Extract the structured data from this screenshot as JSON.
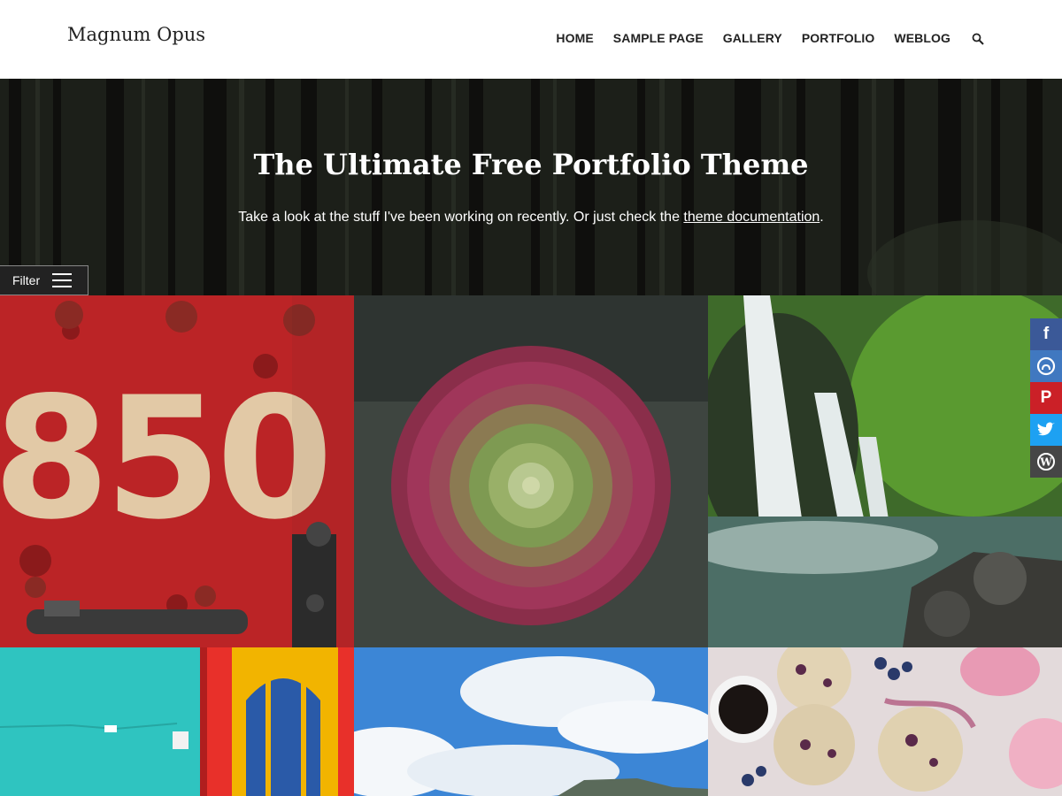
{
  "site": {
    "title": "Magnum Opus"
  },
  "nav": {
    "items": [
      {
        "label": "HOME"
      },
      {
        "label": "SAMPLE PAGE"
      },
      {
        "label": "GALLERY"
      },
      {
        "label": "PORTFOLIO"
      },
      {
        "label": "WEBLOG"
      }
    ],
    "search_icon": "search-icon"
  },
  "hero": {
    "title": "The Ultimate Free Portfolio Theme",
    "subtitle_prefix": "Take a look at the stuff I've been working on recently. Or just check the ",
    "subtitle_link": "theme documentation",
    "subtitle_suffix": "."
  },
  "filter": {
    "label": "Filter",
    "icon": "menu-icon"
  },
  "portfolio": {
    "items": [
      {
        "name": "rusty-850-plate"
      },
      {
        "name": "succulent-flower"
      },
      {
        "name": "waterfall"
      },
      {
        "name": "painted-door"
      },
      {
        "name": "blue-sky"
      },
      {
        "name": "blueberry-cookies"
      }
    ]
  },
  "social": {
    "items": [
      {
        "icon": "facebook-icon",
        "glyph": "f",
        "color": "#3b5998"
      },
      {
        "icon": "github-icon",
        "glyph": "",
        "color": "#4078c0"
      },
      {
        "icon": "pinterest-icon",
        "glyph": "P",
        "color": "#cb2027"
      },
      {
        "icon": "twitter-icon",
        "glyph": "",
        "color": "#1da1f2"
      },
      {
        "icon": "wordpress-icon",
        "glyph": "W",
        "color": "#464646"
      }
    ]
  }
}
